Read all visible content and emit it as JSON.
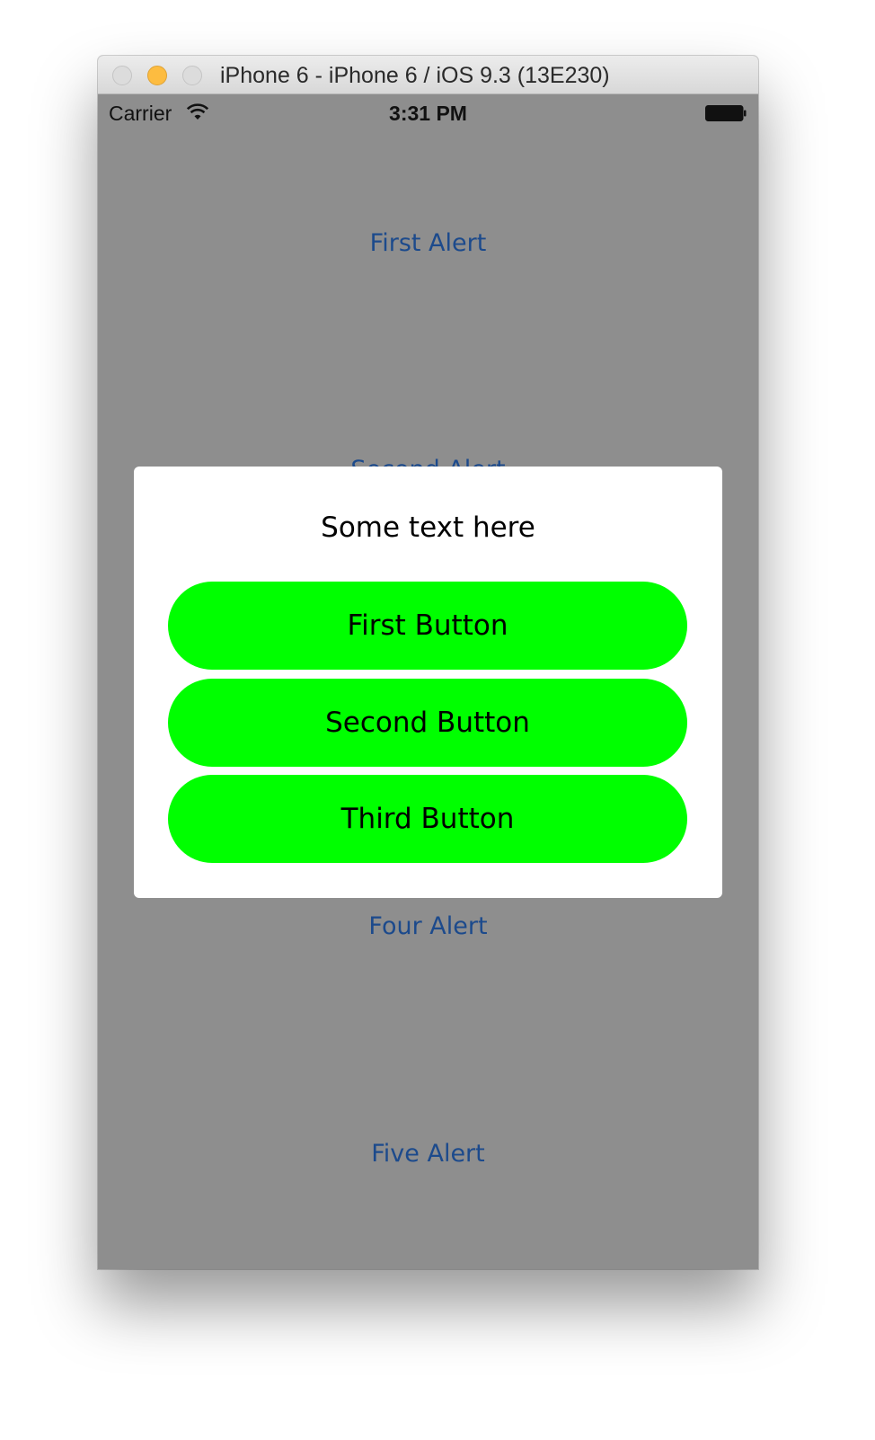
{
  "window": {
    "title": "iPhone 6 - iPhone 6 / iOS 9.3 (13E230)"
  },
  "status_bar": {
    "carrier": "Carrier",
    "time": "3:31 PM",
    "wifi_icon": "wifi-icon",
    "battery_icon": "battery-icon"
  },
  "alerts": {
    "first": "First Alert",
    "second": "Second Alert",
    "four": "Four Alert",
    "five": "Five Alert"
  },
  "dialog": {
    "text": "Some text here",
    "buttons": [
      "First Button",
      "Second Button",
      "Third Button"
    ]
  },
  "colors": {
    "button_green": "#00ff00",
    "link_blue": "#1c4a8c",
    "screen_dim": "#8e8e8e"
  }
}
